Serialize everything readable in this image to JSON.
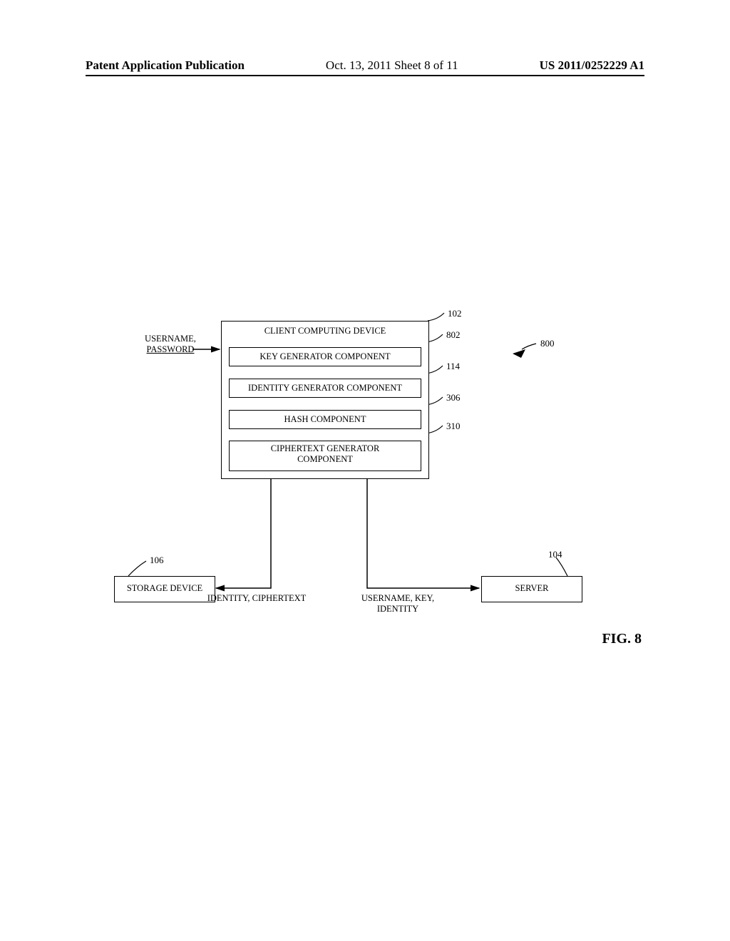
{
  "header": {
    "left": "Patent Application Publication",
    "mid": "Oct. 13, 2011   Sheet 8 of 11",
    "right": "US 2011/0252229 A1"
  },
  "input_label_line1": "USERNAME,",
  "input_label_line2": "PASSWORD",
  "client_title": "CLIENT COMPUTING DEVICE",
  "key_gen": "KEY GENERATOR COMPONENT",
  "identity_gen": "IDENTITY GENERATOR COMPONENT",
  "hash": "HASH COMPONENT",
  "cipher_line1": "CIPHERTEXT GENERATOR",
  "cipher_line2": "COMPONENT",
  "storage": "STORAGE DEVICE",
  "server": "SERVER",
  "to_storage_label": "IDENTITY, CIPHERTEXT",
  "to_server_line1": "USERNAME, KEY,",
  "to_server_line2": "IDENTITY",
  "ref": {
    "r102": "102",
    "r800": "800",
    "r802": "802",
    "r114": "114",
    "r306": "306",
    "r310": "310",
    "r106": "106",
    "r104": "104"
  },
  "fig": "FIG. 8"
}
